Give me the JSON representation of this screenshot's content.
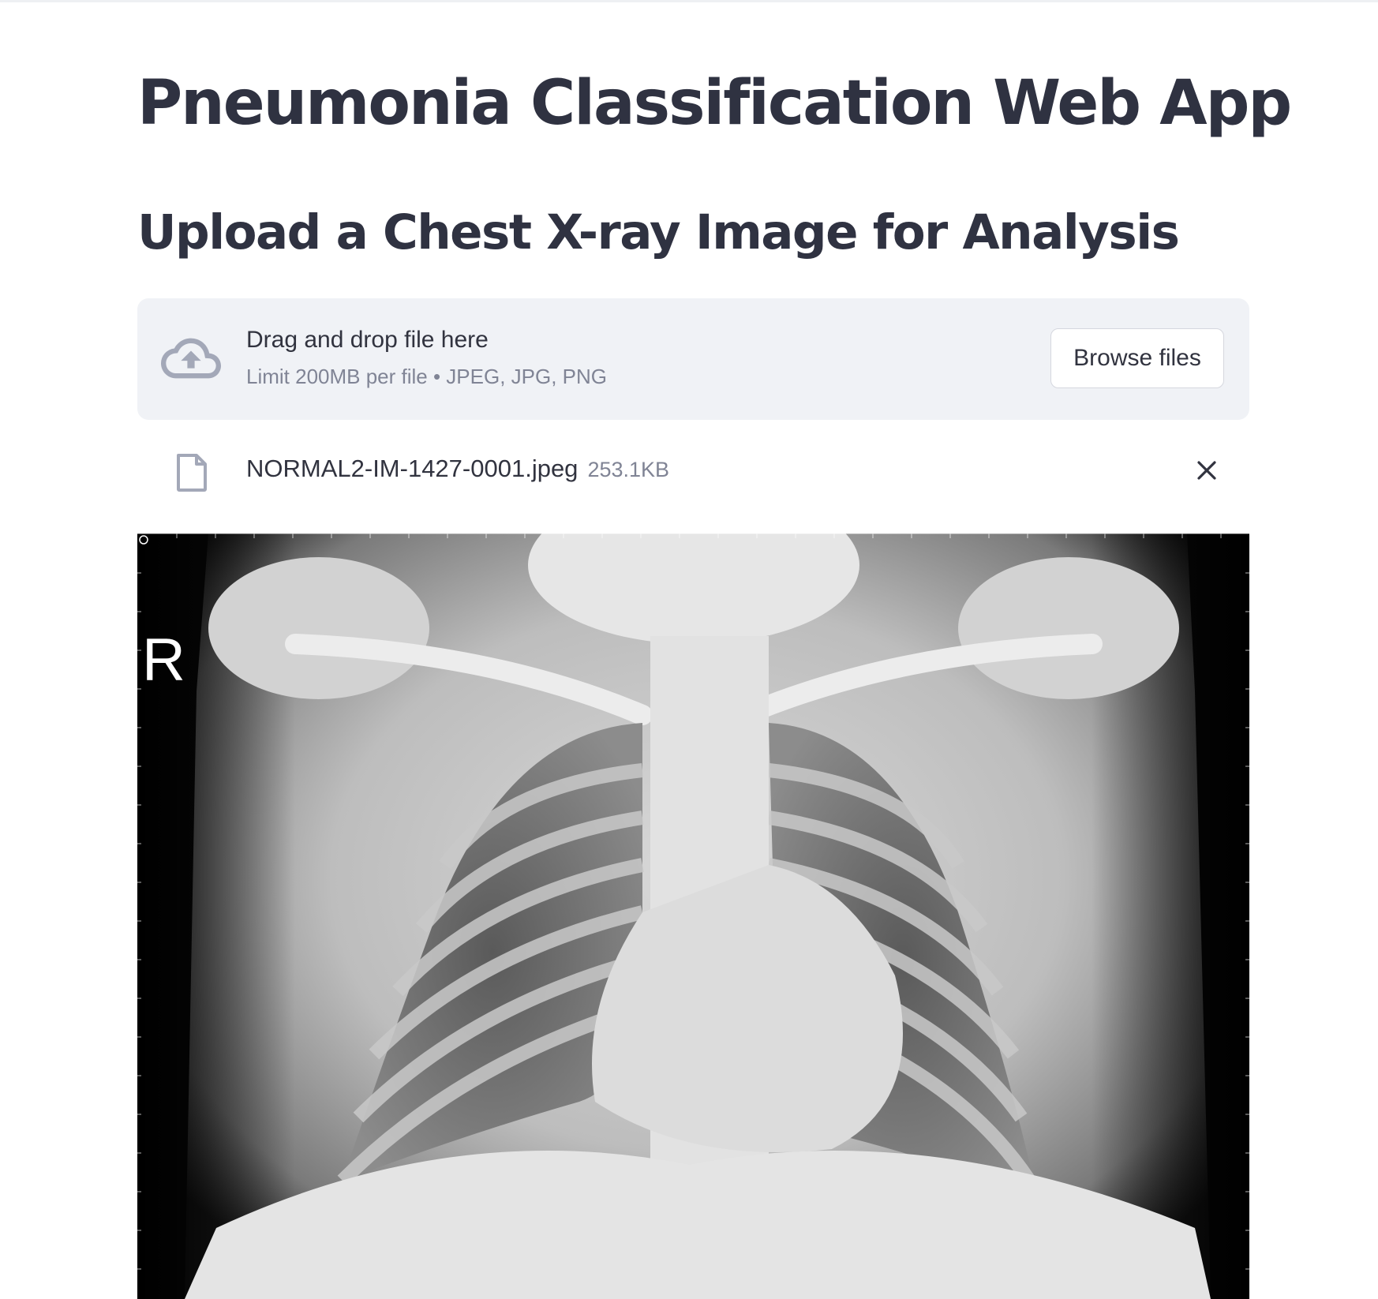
{
  "page": {
    "title": "Pneumonia Classification Web App",
    "subtitle": "Upload a Chest X-ray Image for Analysis"
  },
  "uploader": {
    "primary_text": "Drag and drop file here",
    "secondary_text": "Limit 200MB per file • JPEG, JPG, PNG",
    "browse_label": "Browse files",
    "icon": "cloud-upload-icon"
  },
  "uploaded_file": {
    "name": "NORMAL2-IM-1427-0001.jpeg",
    "size": "253.1KB",
    "icon": "file-icon",
    "remove_icon": "close-icon"
  },
  "image": {
    "marker": "R"
  },
  "colors": {
    "heading": "#2f3241",
    "dropzone_bg": "#f0f2f6",
    "muted_text": "#808495",
    "icon": "#a3a8b8"
  }
}
